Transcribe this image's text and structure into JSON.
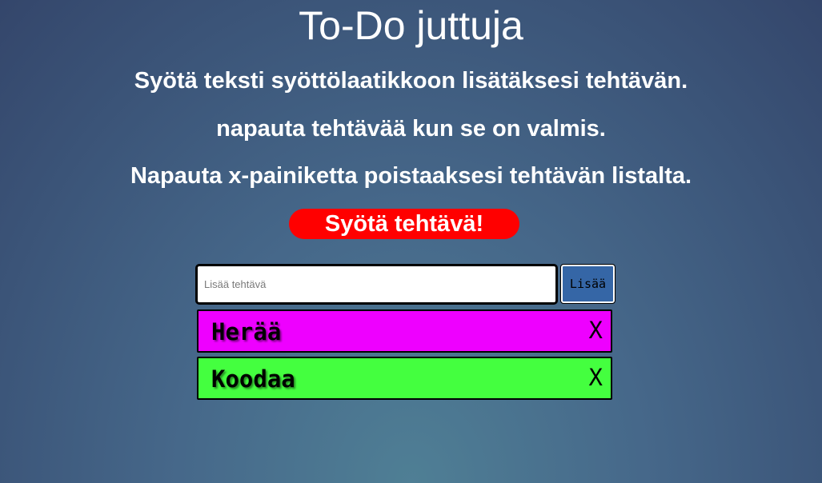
{
  "header": {
    "title": "To-Do juttuja"
  },
  "instructions": {
    "line1": "Syötä teksti syöttölaatikkoon lisätäksesi tehtävän.",
    "line2": "napauta tehtävää kun se on valmis.",
    "line3": "Napauta x-painiketta poistaaksesi tehtävän listalta."
  },
  "cta": {
    "label": "Syötä tehtävä!",
    "color": "#ff0000"
  },
  "form": {
    "input_placeholder": "Lisää tehtävä",
    "input_value": "",
    "add_label": "Lisää",
    "add_color": "#3566a6"
  },
  "todos": [
    {
      "text": "Herää",
      "remove_label": "X",
      "color": "#ee00ff"
    },
    {
      "text": "Koodaa",
      "remove_label": "X",
      "color": "#44ff3f"
    }
  ]
}
